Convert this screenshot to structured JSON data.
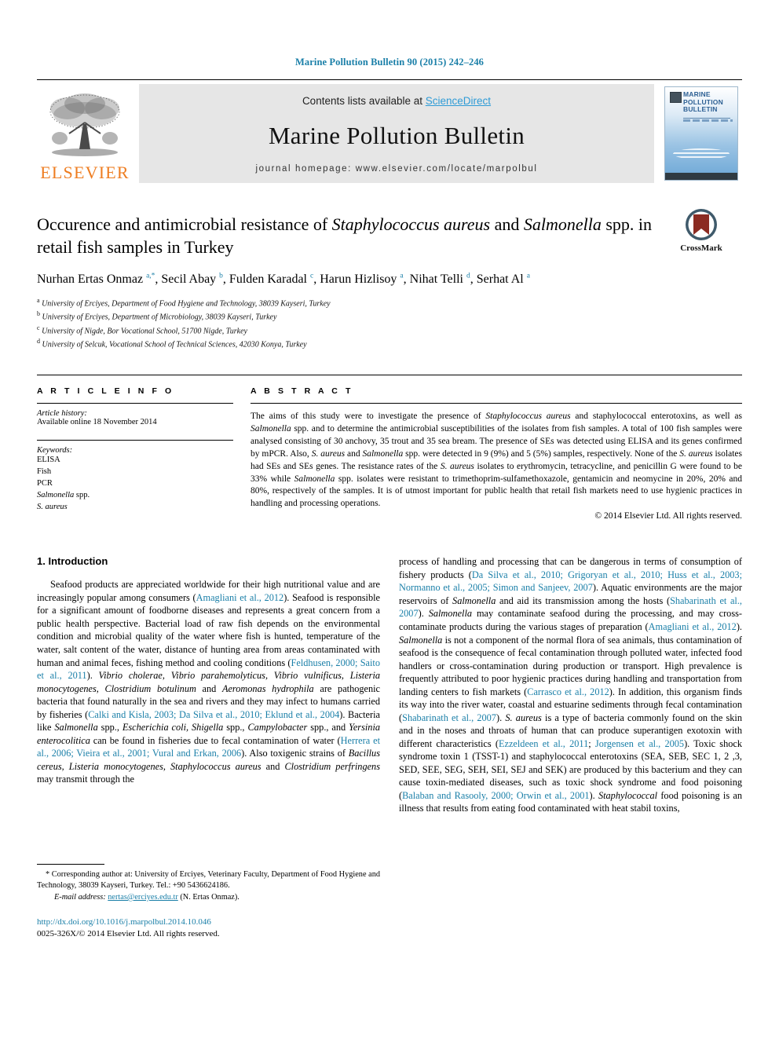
{
  "running_head": "Marine Pollution Bulletin 90 (2015) 242–246",
  "masthead": {
    "publisher_name": "ELSEVIER",
    "contents_prefix": "Contents lists available at ",
    "contents_link": "ScienceDirect",
    "journal_title": "Marine Pollution Bulletin",
    "journal_homepage": "journal homepage: www.elsevier.com/locate/marpolbul",
    "cover": {
      "title_line1": "MARINE",
      "title_line2": "POLLUTION",
      "title_line3": "BULLETIN"
    }
  },
  "article": {
    "title_part1": "Occurence and antimicrobial resistance of ",
    "title_italic1": "Staphylococcus aureus",
    "title_part2": " and ",
    "title_italic2": "Salmonella",
    "title_part3": " spp. in retail fish samples in Turkey",
    "authors": "Nurhan Ertas Onmaz a,*, Secil Abay b, Fulden Karadal c, Harun Hizlisoy a, Nihat Telli d, Serhat Al a",
    "affiliations": [
      "a University of Erciyes, Department of Food Hygiene and Technology, 38039 Kayseri, Turkey",
      "b University of Erciyes, Department of Microbiology, 38039 Kayseri, Turkey",
      "c University of Nigde, Bor Vocational School, 51700 Nigde, Turkey",
      "d University of Selcuk, Vocational School of Technical Sciences, 42030 Konya, Turkey"
    ],
    "crossmark_label": "CrossMark"
  },
  "article_info": {
    "heading": "A R T I C L E   I N F O",
    "history_label": "Article history:",
    "history_value": "Available online 18 November 2014",
    "keywords_label": "Keywords:",
    "keywords": [
      "ELISA",
      "Fish",
      "PCR",
      "Salmonella spp.",
      "S. aureus"
    ]
  },
  "abstract": {
    "heading": "A B S T R A C T",
    "text": "The aims of this study were to investigate the presence of Staphylococcus aureus and staphylococcal enterotoxins, as well as Salmonella spp. and to determine the antimicrobial susceptibilities of the isolates from fish samples. A total of 100 fish samples were analysed consisting of 30 anchovy, 35 trout and 35 sea bream. The presence of SEs was detected using ELISA and its genes confirmed by mPCR. Also, S. aureus and Salmonella spp. were detected in 9 (9%) and 5 (5%) samples, respectively. None of the S. aureus isolates had SEs and SEs genes. The resistance rates of the S. aureus isolates to erythromycin, tetracycline, and penicillin G were found to be 33% while Salmonella spp. isolates were resistant to trimethoprim-sulfamethoxazole, gentamicin and neomycine in 20%, 20% and 80%, respectively of the samples. It is of utmost important for public health that retail fish markets need to use hygienic practices in handling and processing operations.",
    "copyright": "© 2014 Elsevier Ltd. All rights reserved."
  },
  "introduction": {
    "heading": "1. Introduction",
    "left_paragraph": "Seafood products are appreciated worldwide for their high nutritional value and are increasingly popular among consumers (Amagliani et al., 2012). Seafood is responsible for a significant amount of foodborne diseases and represents a great concern from a public health perspective. Bacterial load of raw fish depends on the environmental condition and microbial quality of the water where fish is hunted, temperature of the water, salt content of the water, distance of hunting area from areas contaminated with human and animal feces, fishing method and cooling conditions (Feldhusen, 2000; Saito et al., 2011). Vibrio cholerae, Vibrio parahemolyticus, Vibrio vulnificus, Listeria monocytogenes, Clostridium botulinum and Aeromonas hydrophila are pathogenic bacteria that found naturally in the sea and rivers and they may infect to humans carried by fisheries (Calki and Kisla, 2003; Da Silva et al., 2010; Eklund et al., 2004). Bacteria like Salmonella spp., Escherichia coli, Shigella spp., Campylobacter spp., and Yersinia enterocolitica can be found in fisheries due to fecal contamination of water (Herrera et al., 2006; Vieira et al., 2001; Vural and Erkan, 2006). Also toxigenic strains of Bacillus cereus, Listeria monocytogenes, Staphylococcus aureus and Clostridium perfringens may transmit through the",
    "right_paragraph": "process of handling and processing that can be dangerous in terms of consumption of fishery products (Da Silva et al., 2010; Grigoryan et al., 2010; Huss et al., 2003; Normanno et al., 2005; Simon and Sanjeev, 2007). Aquatic environments are the major reservoirs of Salmonella and aid its transmission among the hosts (Shabarinath et al., 2007). Salmonella may contaminate seafood during the processing, and may cross-contaminate products during the various stages of preparation (Amagliani et al., 2012). Salmonella is not a component of the normal flora of sea animals, thus contamination of seafood is the consequence of fecal contamination through polluted water, infected food handlers or cross-contamination during production or transport. High prevalence is frequently attributed to poor hygienic practices during handling and transportation from landing centers to fish markets (Carrasco et al., 2012). In addition, this organism finds its way into the river water, coastal and estuarine sediments through fecal contamination (Shabarinath et al., 2007). S. aureus is a type of bacteria commonly found on the skin and in the noses and throats of human that can produce superantigen exotoxin with different characteristics (Ezzeldeen et al., 2011; Jorgensen et al., 2005). Toxic shock syndrome toxin 1 (TSST-1) and staphylococcal enterotoxins (SEA, SEB, SEC 1, 2 ,3, SED, SEE, SEG, SEH, SEI, SEJ and SEK) are produced by this bacterium and they can cause toxin-mediated diseases, such as toxic shock syndrome and food poisoning (Balaban and Rasooly, 2000; Orwin et al., 2001). Staphylococcal food poisoning is an illness that results from eating food contaminated with heat stabil toxins,"
  },
  "footnote": {
    "marker": "*",
    "text": "Corresponding author at: University of Erciyes, Veterinary Faculty, Department of Food Hygiene and Technology, 38039 Kayseri, Turkey. Tel.: +90 5436624186.",
    "email_label": "E-mail address:",
    "email": "nertas@erciyes.edu.tr",
    "email_owner": "(N. Ertas Onmaz)."
  },
  "footer": {
    "doi": "http://dx.doi.org/10.1016/j.marpolbul.2014.10.046",
    "issn_line": "0025-326X/© 2014 Elsevier Ltd. All rights reserved."
  },
  "colors": {
    "link": "#1a7fa8",
    "sciencedirect": "#2e9bd6",
    "elsevier_orange": "#ee7d21",
    "band_bg": "#e6e6e6",
    "crossmark_red": "#8b2b22",
    "crossmark_blue": "#3f5a6b"
  }
}
